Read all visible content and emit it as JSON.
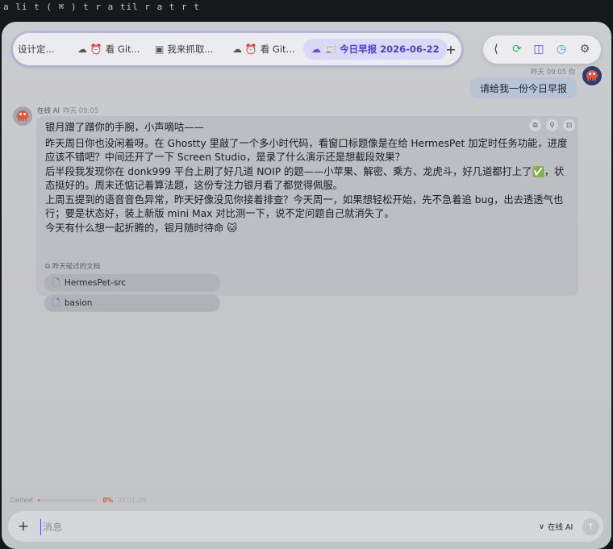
{
  "terminal": {
    "text": "a  li  t   ( ⌘ )    t  r   a   til   r   a   t  r    t"
  },
  "tabs": [
    {
      "icon": "",
      "label": "设计定...",
      "active": false
    },
    {
      "icon": "☁ ⏰",
      "label": "看 Git...",
      "active": false
    },
    {
      "icon": "▣",
      "label": "我来抓取...",
      "active": false
    },
    {
      "icon": "☁ ⏰",
      "label": "看 Git...",
      "active": false
    },
    {
      "icon": "☁ 📰",
      "label": "今日早报 2026-06-22",
      "active": true
    }
  ],
  "add_tab": "+",
  "toolbar": {
    "collapse": "⟨",
    "schedule": "⟳",
    "split": "◫",
    "history": "◷",
    "settings": "⚙"
  },
  "user_message": {
    "meta": "昨天 09:05  你",
    "text": "请给我一份今日早报"
  },
  "ai_message": {
    "sender": "在线 AI",
    "time": "昨天 09:05",
    "actions": [
      "⧉",
      "⚲",
      "⊡"
    ],
    "paragraphs": [
      "银月蹭了蹭你的手腕，小声嘀咕——",
      "昨天周日你也没闲着呀。在 Ghostty 里敲了一个多小时代码，看窗口标题像是在给 HermesPet 加定时任务功能，进度应该不错吧？中间还开了一下 Screen Studio，是录了什么演示还是想截段效果？",
      "后半段我发现你在 donk999 平台上刷了好几道 NOIP 的题——小苹果、解密、乘方、龙虎斗，好几道都打上了✅，状态挺好的。周末还惦记着算法题，这份专注力银月看了都觉得佩服。",
      "上周五提到的语音音色异常，昨天好像没见你接着排查？今天周一，如果想轻松开始，先不急着追 bug，出去透透气也行；要是状态好，装上新版 mini Max 对比测一下，说不定问题自己就消失了。",
      "今天有什么想一起折腾的，银月随时待命 🐱"
    ],
    "ref_label": "昨天碰过的文档",
    "files": [
      "HermesPet-src",
      "basion"
    ]
  },
  "context": {
    "label": "Context",
    "percent": "0%",
    "fraction": 0.003,
    "tokens": "387/1.2M"
  },
  "composer": {
    "placeholder": "消息",
    "model": "在线 AI",
    "chevron": "∨",
    "send": "↑"
  },
  "colors": {
    "accent": "#5b4fe0",
    "active_tab_bg": "#d9d8f6",
    "user_bubble": "#b7c4d6",
    "context_fill": "#ef5a3c"
  }
}
